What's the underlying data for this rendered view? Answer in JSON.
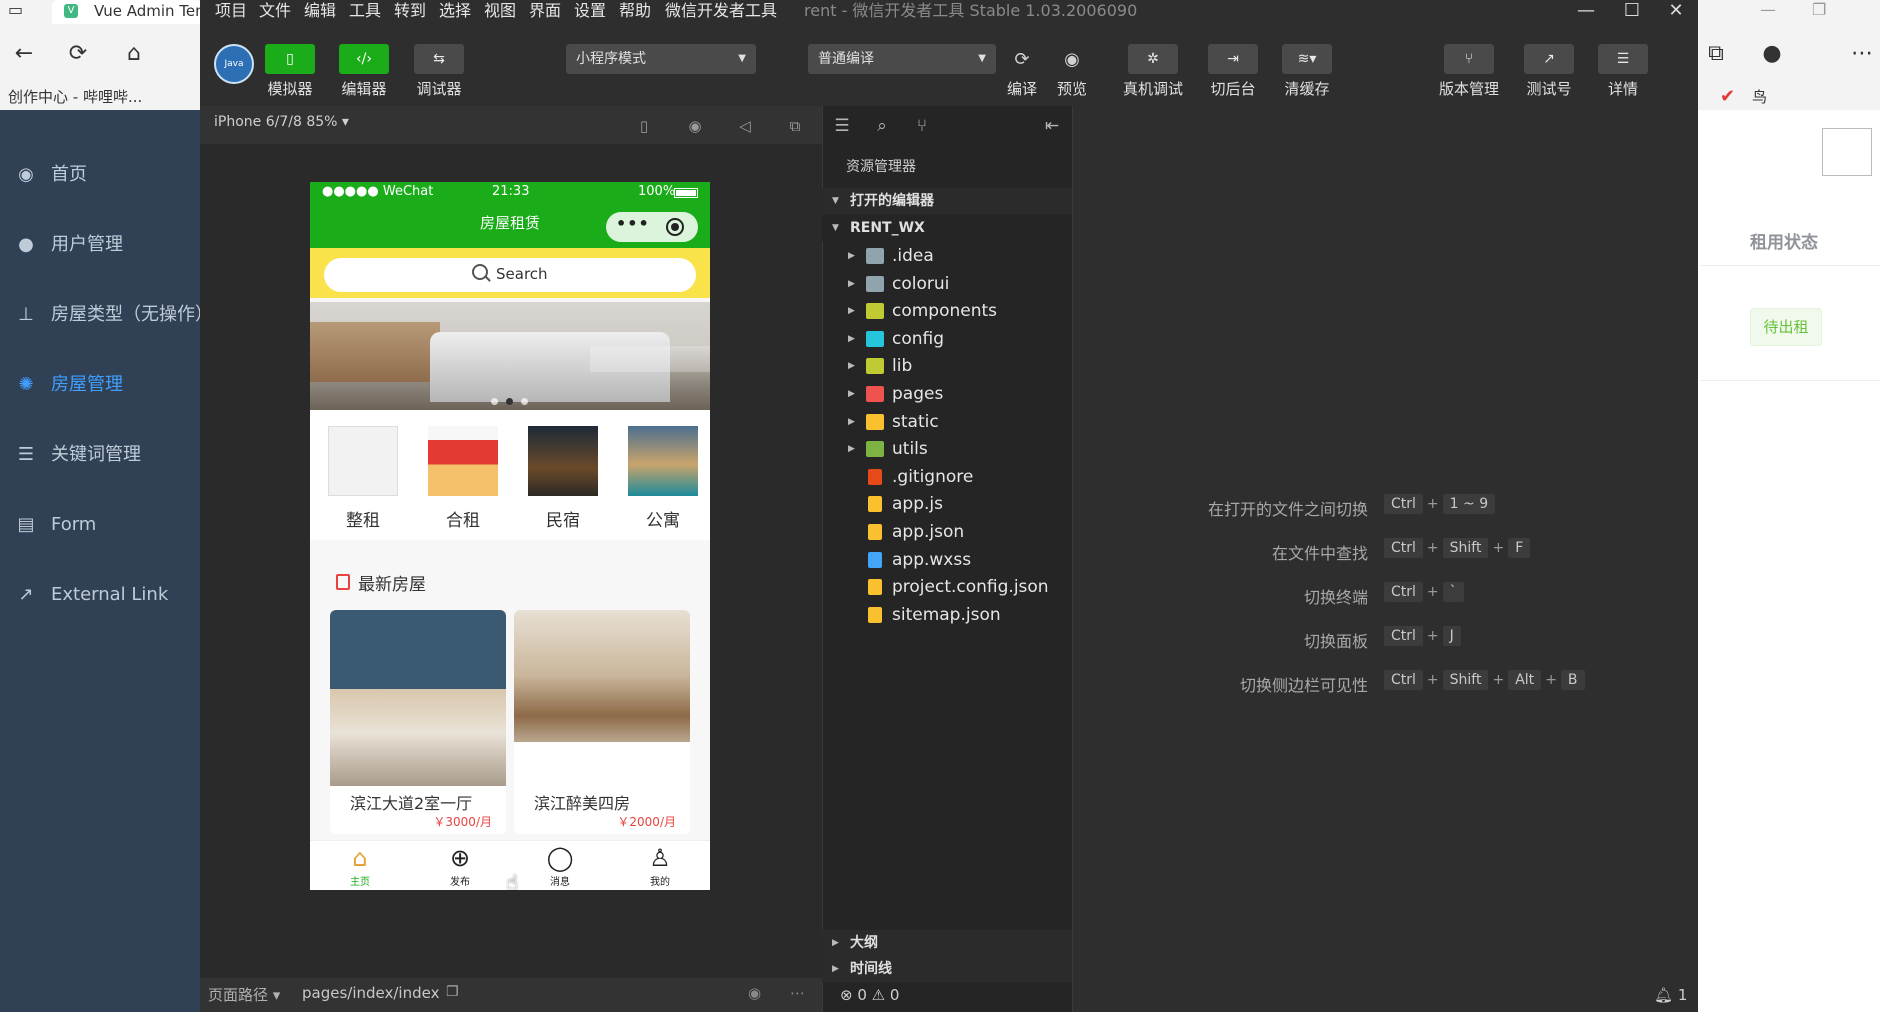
{
  "browser": {
    "tab_title": "Vue Admin Tem",
    "bookmark": "创作中心 - 哔哩哔...",
    "extension_icon_text": "鸟"
  },
  "admin_sidebar": {
    "items": [
      {
        "label": "首页",
        "icon": "dashboard-icon"
      },
      {
        "label": "用户管理",
        "icon": "user-icon"
      },
      {
        "label": "房屋类型（无操作）",
        "icon": "tree-icon"
      },
      {
        "label": "房屋管理",
        "icon": "gear-icon"
      },
      {
        "label": "关键词管理",
        "icon": "list-icon"
      },
      {
        "label": "Form",
        "icon": "form-icon"
      },
      {
        "label": "External Link",
        "icon": "external-link-icon"
      }
    ],
    "active_index": 3
  },
  "admin_content": {
    "column_header": "租用状态",
    "status_tag": "待出租"
  },
  "devtools": {
    "menu": [
      "项目",
      "文件",
      "编辑",
      "工具",
      "转到",
      "选择",
      "视图",
      "界面",
      "设置",
      "帮助",
      "微信开发者工具"
    ],
    "title": "rent - 微信开发者工具 Stable 1.03.2006090",
    "toolbar": {
      "avatar_text": "Java",
      "simulator": "模拟器",
      "editor": "编辑器",
      "debugger": "调试器",
      "mode_select": "小程序模式",
      "compile_select": "普通编译",
      "compile": "编译",
      "preview": "预览",
      "remote_debug": "真机调试",
      "background": "切后台",
      "clear_cache": "清缓存",
      "version": "版本管理",
      "test_account": "测试号",
      "details": "详情"
    },
    "simulator": {
      "device": "iPhone 6/7/8 85% ▾",
      "page_path_label": "页面路径 ▾",
      "page_path": "pages/index/index"
    }
  },
  "phone": {
    "status_bar": {
      "carrier": "●●●●● WeChat",
      "time": "21:33",
      "battery": "100%"
    },
    "nav_title": "房屋租赁",
    "capsule_more": "•••",
    "search_placeholder": "Search",
    "categories": [
      {
        "label": "整租"
      },
      {
        "label": "合租"
      },
      {
        "label": "民宿"
      },
      {
        "label": "公寓"
      }
    ],
    "latest_title": "最新房屋",
    "houses": [
      {
        "name": "滨江大道2室一厅",
        "price": "￥3000/月"
      },
      {
        "name": "滨江醉美四房",
        "price": "￥2000/月"
      }
    ],
    "tabs": [
      {
        "label": "主页",
        "icon": "home-icon"
      },
      {
        "label": "发布",
        "icon": "plus-circle-icon"
      },
      {
        "label": "消息",
        "icon": "chat-icon"
      },
      {
        "label": "我的",
        "icon": "profile-icon"
      }
    ],
    "active_tab": 0
  },
  "explorer": {
    "title": "资源管理器",
    "open_editors": "打开的编辑器",
    "project": "RENT_WX",
    "files": [
      {
        "name": ".idea",
        "type": "folder",
        "color": "#90a4ae"
      },
      {
        "name": "colorui",
        "type": "folder",
        "color": "#90a4ae"
      },
      {
        "name": "components",
        "type": "folder",
        "color": "#c0ca33"
      },
      {
        "name": "config",
        "type": "folder",
        "color": "#26c6da"
      },
      {
        "name": "lib",
        "type": "folder",
        "color": "#c0ca33"
      },
      {
        "name": "pages",
        "type": "folder",
        "color": "#ef5350"
      },
      {
        "name": "static",
        "type": "folder",
        "color": "#fbc02d"
      },
      {
        "name": "utils",
        "type": "folder",
        "color": "#7cb342"
      },
      {
        "name": ".gitignore",
        "type": "file",
        "color": "#e64a19"
      },
      {
        "name": "app.js",
        "type": "file",
        "color": "#fbc02d"
      },
      {
        "name": "app.json",
        "type": "file",
        "color": "#fbc02d"
      },
      {
        "name": "app.wxss",
        "type": "file",
        "color": "#42a5f5"
      },
      {
        "name": "project.config.json",
        "type": "file",
        "color": "#fbc02d"
      },
      {
        "name": "sitemap.json",
        "type": "file",
        "color": "#fbc02d"
      }
    ],
    "outline": "大纲",
    "timeline": "时间线",
    "status": "⊗ 0 ⚠ 0"
  },
  "editor": {
    "shortcuts": [
      {
        "label": "在打开的文件之间切换",
        "keys": [
          "Ctrl",
          "1 ~ 9"
        ]
      },
      {
        "label": "在文件中查找",
        "keys": [
          "Ctrl",
          "Shift",
          "F"
        ]
      },
      {
        "label": "切换终端",
        "keys": [
          "Ctrl",
          "`"
        ]
      },
      {
        "label": "切换面板",
        "keys": [
          "Ctrl",
          "J"
        ]
      },
      {
        "label": "切换侧边栏可见性",
        "keys": [
          "Ctrl",
          "Shift",
          "Alt",
          "B"
        ]
      }
    ],
    "notifications": "1"
  }
}
